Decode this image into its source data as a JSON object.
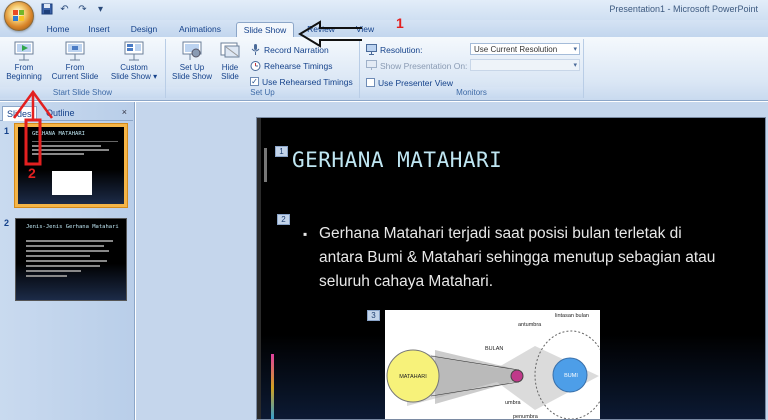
{
  "window": {
    "title": "Presentation1 - Microsoft PowerPoint"
  },
  "quick_access": {
    "icons": [
      "save-icon",
      "undo-icon",
      "redo-icon",
      "customize-icon"
    ]
  },
  "tabs": [
    {
      "label": "Home",
      "active": false
    },
    {
      "label": "Insert",
      "active": false
    },
    {
      "label": "Design",
      "active": false
    },
    {
      "label": "Animations",
      "active": false
    },
    {
      "label": "Slide Show",
      "active": true
    },
    {
      "label": "Review",
      "active": false
    },
    {
      "label": "View",
      "active": false
    }
  ],
  "ribbon": {
    "start_group": {
      "label": "Start Slide Show",
      "from_beginning": {
        "line1": "From",
        "line2": "Beginning"
      },
      "from_current": {
        "line1": "From",
        "line2": "Current Slide"
      },
      "custom": {
        "line1": "Custom",
        "line2": "Slide Show"
      }
    },
    "setup_group": {
      "label": "Set Up",
      "setup_show": {
        "line1": "Set Up",
        "line2": "Slide Show"
      },
      "hide_slide": {
        "line1": "Hide",
        "line2": "Slide"
      },
      "record_narration": "Record Narration",
      "rehearse_timings": "Rehearse Timings",
      "use_rehearsed": "Use Rehearsed Timings",
      "use_rehearsed_checked": true
    },
    "monitors_group": {
      "label": "Monitors",
      "resolution_label": "Resolution:",
      "resolution_value": "Use Current Resolution",
      "show_on_label": "Show Presentation On:",
      "show_on_value": "",
      "presenter_view": "Use Presenter View",
      "presenter_view_checked": false
    }
  },
  "panel": {
    "tab_slides": "Slides",
    "tab_outline": "Outline",
    "close": "×",
    "thumbnails": [
      {
        "number": "1",
        "title": "GERHANA MATAHARI",
        "selected": true
      },
      {
        "number": "2",
        "title": "Jenis-Jenis Gerhana Matahari",
        "selected": false
      }
    ]
  },
  "slide": {
    "title": "GERHANA MATAHARI",
    "placeholder_numbers": [
      "1",
      "2",
      "3"
    ],
    "bullet": "Gerhana Matahari terjadi saat posisi bulan terletak di antara Bumi & Matahari sehingga menutup sebagian atau seluruh cahaya Matahari.",
    "diagram_labels": {
      "sun": "MATAHARI",
      "moon": "BULAN",
      "earth": "BUMI",
      "antumbra": "antumbra",
      "orbit": "lintasan bulan",
      "umbra": "umbra",
      "penumbra": "penumbra"
    }
  },
  "annotations": {
    "first": "1",
    "second": "2",
    "color": "#e32020"
  }
}
